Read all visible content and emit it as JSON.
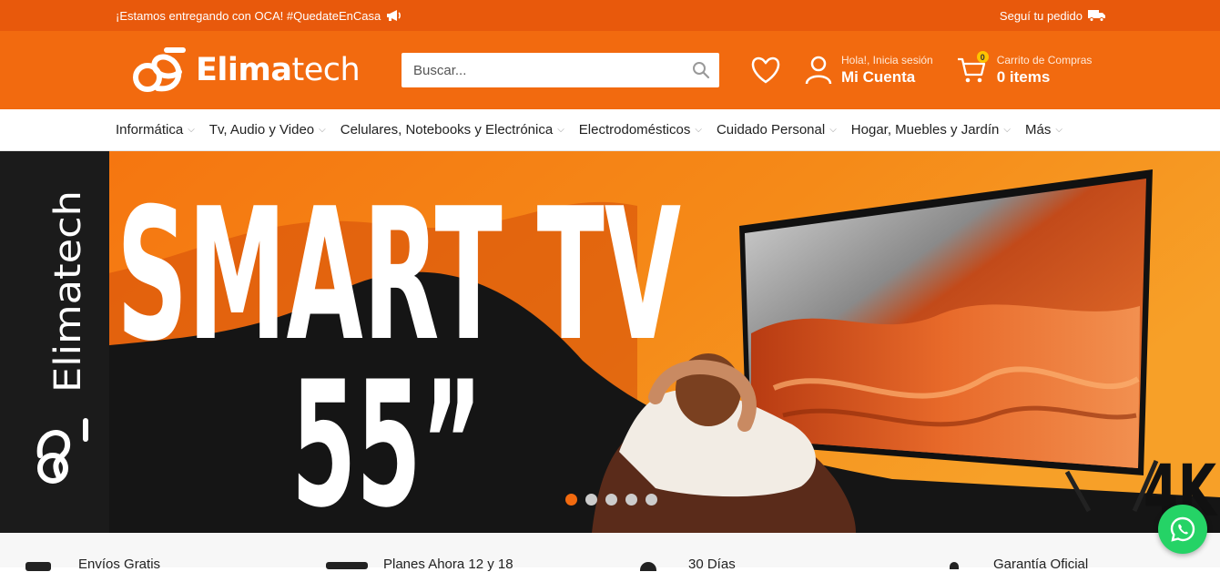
{
  "topbar": {
    "announcement": "¡Estamos entregando con OCA! #QuedateEnCasa",
    "track_order": "Seguí tu pedido"
  },
  "header": {
    "logo_text_a": "Elima",
    "logo_text_b": "tech",
    "search_placeholder": "Buscar...",
    "account_greeting": "Hola!, Inicia sesión",
    "account_label": "Mi Cuenta",
    "cart_title": "Carrito de Compras",
    "cart_items": "0 items",
    "cart_count": "0"
  },
  "nav": {
    "items": [
      "Informática",
      "Tv, Audio y Video",
      "Celulares, Notebooks y Electrónica",
      "Electrodomésticos",
      "Cuidado Personal",
      "Hogar, Muebles y Jardín",
      "Más"
    ]
  },
  "hero": {
    "brand_vertical": "Elimatech",
    "headline": "SMART TV",
    "size": "55”",
    "badge": "4K",
    "slides": 5,
    "active_slide": 1
  },
  "features": [
    "Envíos Gratis",
    "Planes Ahora 12 y 18",
    "30 Días",
    "Garantía Oficial"
  ],
  "colors": {
    "brand_orange": "#f26a0f",
    "topbar_orange": "#e8590c",
    "whatsapp_green": "#25d366"
  }
}
